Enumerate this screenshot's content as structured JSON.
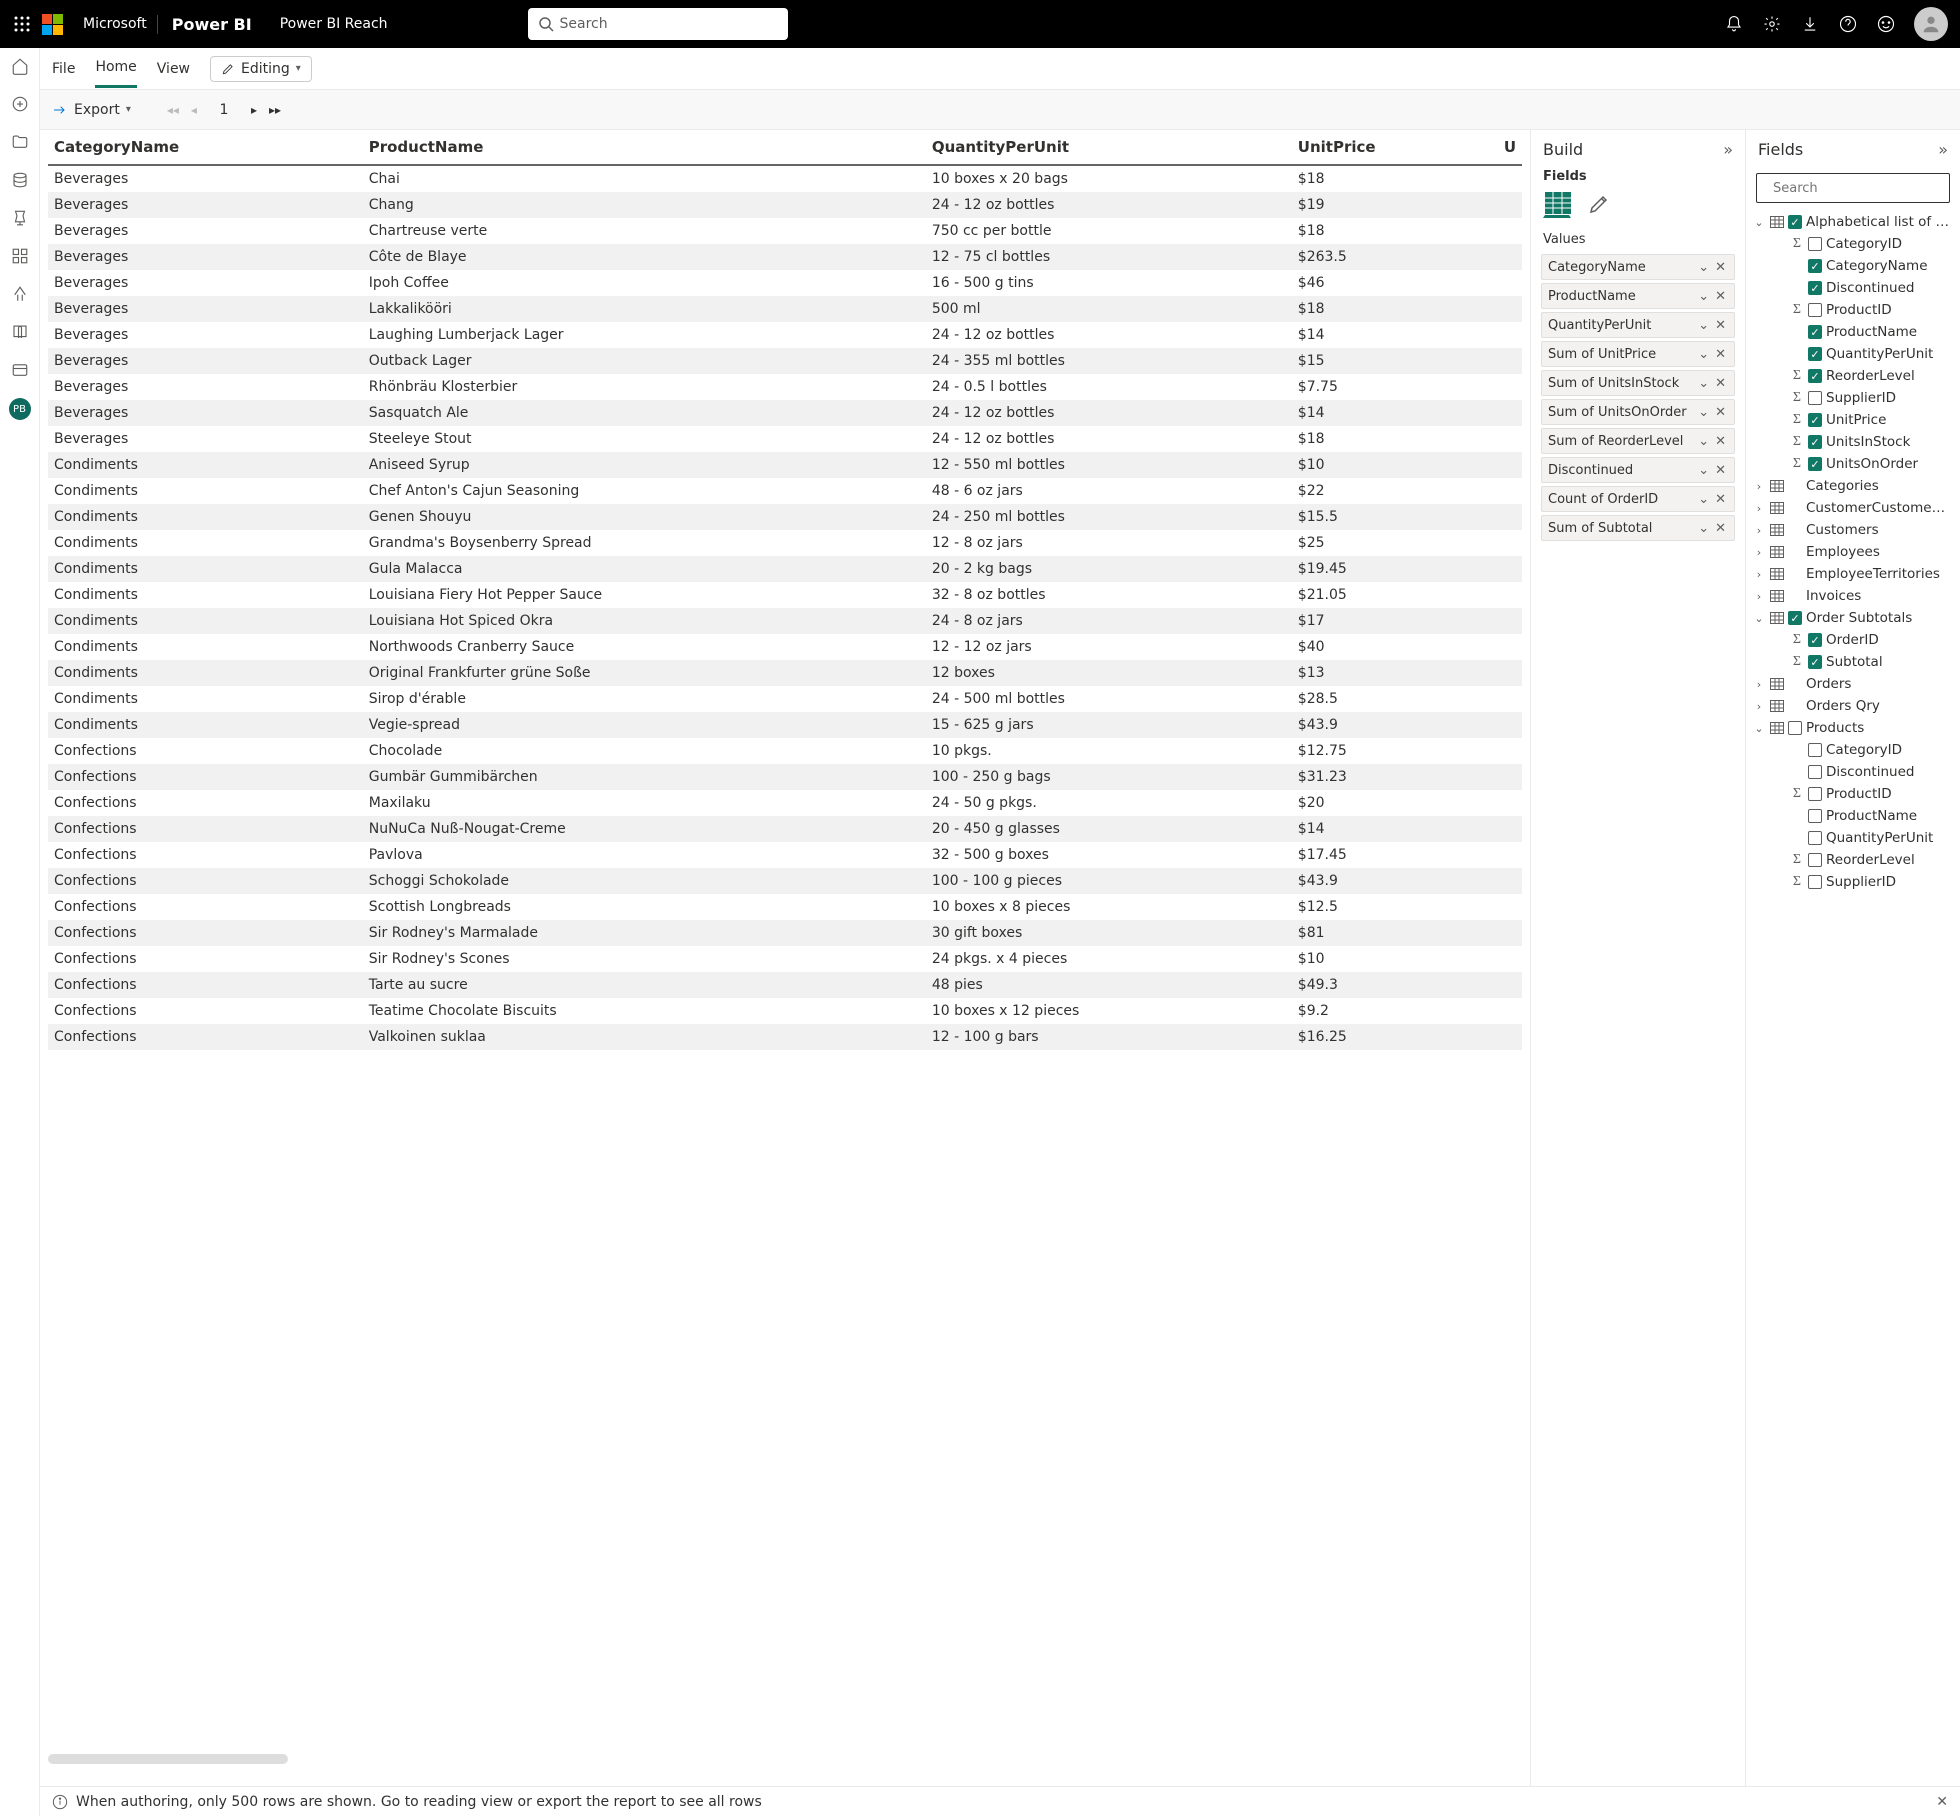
{
  "top": {
    "brand": "Power BI",
    "workspace": "Power BI Reach",
    "search_placeholder": "Search"
  },
  "menu": {
    "file": "File",
    "home": "Home",
    "view": "View",
    "editing": "Editing"
  },
  "toolbar": {
    "export": "Export",
    "page": "1"
  },
  "table": {
    "headers": [
      "CategoryName",
      "ProductName",
      "QuantityPerUnit",
      "UnitPrice",
      "U"
    ],
    "rows": [
      [
        "Beverages",
        "Chai",
        "10 boxes x 20 bags",
        "$18"
      ],
      [
        "Beverages",
        "Chang",
        "24 - 12 oz bottles",
        "$19"
      ],
      [
        "Beverages",
        "Chartreuse verte",
        "750 cc per bottle",
        "$18"
      ],
      [
        "Beverages",
        "Côte de Blaye",
        "12 - 75 cl bottles",
        "$263.5"
      ],
      [
        "Beverages",
        "Ipoh Coffee",
        "16 - 500 g tins",
        "$46"
      ],
      [
        "Beverages",
        "Lakkalikööri",
        "500 ml",
        "$18"
      ],
      [
        "Beverages",
        "Laughing Lumberjack Lager",
        "24 - 12 oz bottles",
        "$14"
      ],
      [
        "Beverages",
        "Outback Lager",
        "24 - 355 ml bottles",
        "$15"
      ],
      [
        "Beverages",
        "Rhönbräu Klosterbier",
        "24 - 0.5 l bottles",
        "$7.75"
      ],
      [
        "Beverages",
        "Sasquatch Ale",
        "24 - 12 oz bottles",
        "$14"
      ],
      [
        "Beverages",
        "Steeleye Stout",
        "24 - 12 oz bottles",
        "$18"
      ],
      [
        "Condiments",
        "Aniseed Syrup",
        "12 - 550 ml bottles",
        "$10"
      ],
      [
        "Condiments",
        "Chef Anton's Cajun Seasoning",
        "48 - 6 oz jars",
        "$22"
      ],
      [
        "Condiments",
        "Genen Shouyu",
        "24 - 250 ml bottles",
        "$15.5"
      ],
      [
        "Condiments",
        "Grandma's Boysenberry Spread",
        "12 - 8 oz jars",
        "$25"
      ],
      [
        "Condiments",
        "Gula Malacca",
        "20 - 2 kg bags",
        "$19.45"
      ],
      [
        "Condiments",
        "Louisiana Fiery Hot Pepper Sauce",
        "32 - 8 oz bottles",
        "$21.05"
      ],
      [
        "Condiments",
        "Louisiana Hot Spiced Okra",
        "24 - 8 oz jars",
        "$17"
      ],
      [
        "Condiments",
        "Northwoods Cranberry Sauce",
        "12 - 12 oz jars",
        "$40"
      ],
      [
        "Condiments",
        "Original Frankfurter grüne Soße",
        "12 boxes",
        "$13"
      ],
      [
        "Condiments",
        "Sirop d'érable",
        "24 - 500 ml bottles",
        "$28.5"
      ],
      [
        "Condiments",
        "Vegie-spread",
        "15 - 625 g jars",
        "$43.9"
      ],
      [
        "Confections",
        "Chocolade",
        "10 pkgs.",
        "$12.75"
      ],
      [
        "Confections",
        "Gumbär Gummibärchen",
        "100 - 250 g bags",
        "$31.23"
      ],
      [
        "Confections",
        "Maxilaku",
        "24 - 50 g pkgs.",
        "$20"
      ],
      [
        "Confections",
        "NuNuCa Nuß-Nougat-Creme",
        "20 - 450 g glasses",
        "$14"
      ],
      [
        "Confections",
        "Pavlova",
        "32 - 500 g boxes",
        "$17.45"
      ],
      [
        "Confections",
        "Schoggi Schokolade",
        "100 - 100 g pieces",
        "$43.9"
      ],
      [
        "Confections",
        "Scottish Longbreads",
        "10 boxes x 8 pieces",
        "$12.5"
      ],
      [
        "Confections",
        "Sir Rodney's Marmalade",
        "30 gift boxes",
        "$81"
      ],
      [
        "Confections",
        "Sir Rodney's Scones",
        "24 pkgs. x 4 pieces",
        "$10"
      ],
      [
        "Confections",
        "Tarte au sucre",
        "48 pies",
        "$49.3"
      ],
      [
        "Confections",
        "Teatime Chocolate Biscuits",
        "10 boxes x 12 pieces",
        "$9.2"
      ],
      [
        "Confections",
        "Valkoinen suklaa",
        "12 - 100 g bars",
        "$16.25"
      ]
    ]
  },
  "infobar": "When authoring, only 500 rows are shown. Go to reading view or export the report to see all rows",
  "build": {
    "title": "Build",
    "fields_label": "Fields",
    "values_label": "Values",
    "pills": [
      "CategoryName",
      "ProductName",
      "QuantityPerUnit",
      "Sum of UnitPrice",
      "Sum of UnitsInStock",
      "Sum of UnitsOnOrder",
      "Sum of ReorderLevel",
      "Discontinued",
      "Count of OrderID",
      "Sum of Subtotal"
    ]
  },
  "fields": {
    "title": "Fields",
    "search_placeholder": "Search",
    "tables": [
      {
        "name": "Alphabetical list of pro...",
        "open": true,
        "checked": true,
        "fields": [
          {
            "n": "CategoryID",
            "sigma": true,
            "checked": false
          },
          {
            "n": "CategoryName",
            "checked": true
          },
          {
            "n": "Discontinued",
            "checked": true
          },
          {
            "n": "ProductID",
            "sigma": true,
            "checked": false
          },
          {
            "n": "ProductName",
            "checked": true
          },
          {
            "n": "QuantityPerUnit",
            "checked": true
          },
          {
            "n": "ReorderLevel",
            "sigma": true,
            "checked": true
          },
          {
            "n": "SupplierID",
            "sigma": true,
            "checked": false
          },
          {
            "n": "UnitPrice",
            "sigma": true,
            "checked": true
          },
          {
            "n": "UnitsInStock",
            "sigma": true,
            "checked": true
          },
          {
            "n": "UnitsOnOrder",
            "sigma": true,
            "checked": true
          }
        ]
      },
      {
        "name": "Categories",
        "open": false
      },
      {
        "name": "CustomerCustomerDe...",
        "open": false
      },
      {
        "name": "Customers",
        "open": false
      },
      {
        "name": "Employees",
        "open": false
      },
      {
        "name": "EmployeeTerritories",
        "open": false
      },
      {
        "name": "Invoices",
        "open": false
      },
      {
        "name": "Order Subtotals",
        "open": true,
        "checked": true,
        "fields": [
          {
            "n": "OrderID",
            "sigma": true,
            "checked": true
          },
          {
            "n": "Subtotal",
            "sigma": true,
            "checked": true
          }
        ]
      },
      {
        "name": "Orders",
        "open": false
      },
      {
        "name": "Orders Qry",
        "open": false
      },
      {
        "name": "Products",
        "open": true,
        "checked": false,
        "fields": [
          {
            "n": "CategoryID",
            "checked": false
          },
          {
            "n": "Discontinued",
            "checked": false
          },
          {
            "n": "ProductID",
            "sigma": true,
            "checked": false
          },
          {
            "n": "ProductName",
            "checked": false
          },
          {
            "n": "QuantityPerUnit",
            "checked": false
          },
          {
            "n": "ReorderLevel",
            "sigma": true,
            "checked": false
          },
          {
            "n": "SupplierID",
            "sigma": true,
            "checked": false
          }
        ]
      }
    ]
  },
  "rail_badge": "PB"
}
